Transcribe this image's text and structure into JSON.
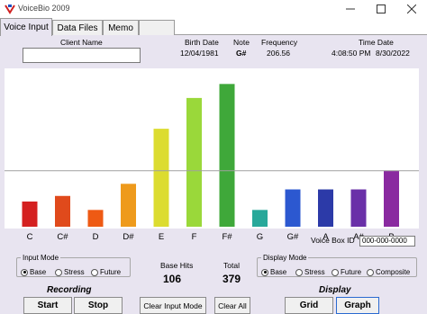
{
  "window": {
    "title": "VoiceBio 2009"
  },
  "tabs": [
    "Voice Input",
    "Data Files",
    "Memo"
  ],
  "header": {
    "client_name_label": "Client Name",
    "client_name_value": "",
    "birth_date_label": "Birth Date",
    "birth_date_value": "12/04/1981",
    "note_label": "Note",
    "note_value": "G#",
    "frequency_label": "Frequency",
    "frequency_value": "206.56",
    "time_date_label": "Time Date",
    "time_value": "4:08:50 PM",
    "date_value": "8/30/2022"
  },
  "chart_data": {
    "type": "bar",
    "categories": [
      "C",
      "C#",
      "D",
      "D#",
      "E",
      "F",
      "F#",
      "G",
      "G#",
      "A",
      "A#",
      "B"
    ],
    "values": [
      27,
      33,
      18,
      46,
      105,
      138,
      153,
      18,
      40,
      40,
      40,
      60
    ],
    "colors": [
      "#d42020",
      "#e04a1c",
      "#ee5a14",
      "#ee9a1c",
      "#dcdc30",
      "#9ad83a",
      "#3fa83a",
      "#28a89a",
      "#2c58d0",
      "#2c3aa8",
      "#6a30a8",
      "#8a2aa0"
    ],
    "reference_line": 60,
    "ylim": [
      0,
      162
    ]
  },
  "voice_box": {
    "label": "Voice Box ID",
    "value": "000-000-0000"
  },
  "input_mode": {
    "label": "Input Mode",
    "options": [
      "Base",
      "Stress",
      "Future"
    ],
    "selected": "Base"
  },
  "stats": {
    "base_hits_label": "Base Hits",
    "base_hits_value": "106",
    "total_label": "Total",
    "total_value": "379"
  },
  "display_mode": {
    "label": "Display Mode",
    "options": [
      "Base",
      "Stress",
      "Future",
      "Composite"
    ],
    "selected": "Base"
  },
  "recording": {
    "title": "Recording",
    "start_label": "Start",
    "stop_label": "Stop"
  },
  "display": {
    "title": "Display",
    "grid_label": "Grid",
    "graph_label": "Graph"
  },
  "buttons": {
    "clear_input_mode": "Clear Input Mode",
    "clear_all": "Clear All"
  },
  "icons": {
    "app": "voicebio-logo-icon",
    "minimize": "minimize-icon",
    "maximize": "maximize-icon",
    "close": "close-icon"
  }
}
